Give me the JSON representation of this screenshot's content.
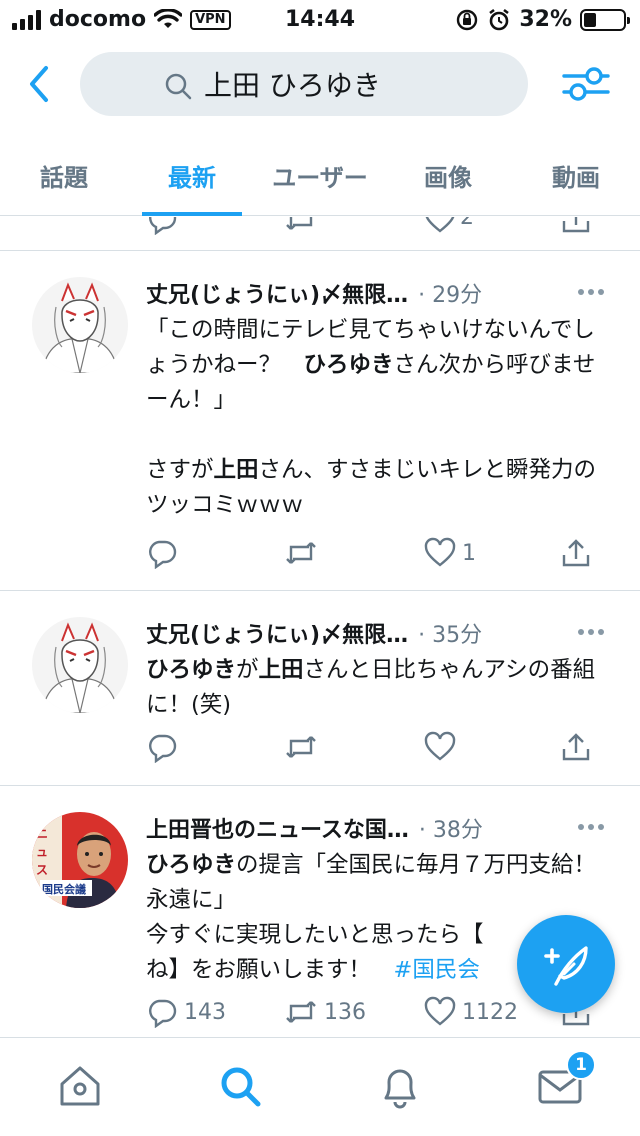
{
  "status_bar": {
    "carrier": "docomo",
    "vpn": "VPN",
    "time": "14:44",
    "battery": "32%",
    "battery_level": 0.32
  },
  "header": {
    "back_icon": "chevron-left-icon",
    "search_query": "上田 ひろゆき",
    "filter_icon": "sliders-icon"
  },
  "tabs": [
    {
      "label": "話題",
      "active": false
    },
    {
      "label": "最新",
      "active": true
    },
    {
      "label": "ユーザー",
      "active": false
    },
    {
      "label": "画像",
      "active": false
    },
    {
      "label": "動画",
      "active": false
    }
  ],
  "partial_tweet": {
    "like_count": "2"
  },
  "tweets": [
    {
      "name": "丈兄(じょうにぃ)〆無限…",
      "time": "· 29分",
      "text_parts": [
        {
          "t": "「この時間にテレビ見てちゃいけないんでしょうかねー？　",
          "b": false
        },
        {
          "t": "ひろゆき",
          "b": true
        },
        {
          "t": "さん次から呼びませーん！」\n\nさすが",
          "b": false
        },
        {
          "t": "上田",
          "b": true
        },
        {
          "t": "さん、すさまじいキレと瞬発力のツッコミｗｗｗ",
          "b": false
        }
      ],
      "replies": "",
      "retweets": "",
      "likes": "1"
    },
    {
      "name": "丈兄(じょうにぃ)〆無限…",
      "time": "· 35分",
      "text_parts": [
        {
          "t": "ひろゆき",
          "b": true
        },
        {
          "t": "が",
          "b": false
        },
        {
          "t": "上田",
          "b": true
        },
        {
          "t": "さんと日比ちゃんアシの番組に！(笑)",
          "b": false
        }
      ],
      "replies": "",
      "retweets": "",
      "likes": ""
    },
    {
      "name": "上田晋也のニュースな国…",
      "time": "· 38分",
      "text_parts": [
        {
          "t": "ひろゆき",
          "b": true
        },
        {
          "t": "の提言「全国民に毎月７万円支給！永遠に」\n今すぐに実現したいと思ったら【",
          "b": false
        },
        {
          "t": "ね】をお願いします！　",
          "b": false
        },
        {
          "t": "#国民会",
          "tag": true
        }
      ],
      "avatar_text": "ニュース な国民会議",
      "replies": "143",
      "retweets": "136",
      "likes": "1122"
    }
  ],
  "bottom_nav": [
    {
      "icon": "home-icon"
    },
    {
      "icon": "search-icon",
      "active": true
    },
    {
      "icon": "bell-icon"
    },
    {
      "icon": "mail-icon",
      "badge": "1"
    }
  ],
  "fab": {
    "icon": "compose-feather-icon"
  },
  "colors": {
    "accent": "#1da1f2",
    "secondary_text": "#657786",
    "divider": "#d8dfe4"
  }
}
